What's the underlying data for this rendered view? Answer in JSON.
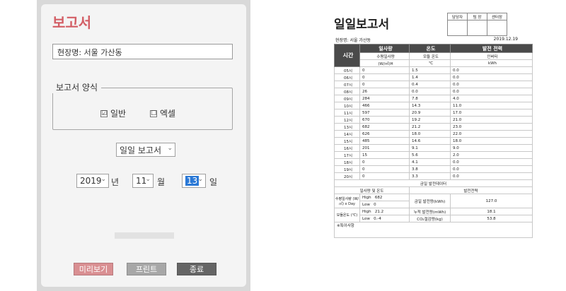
{
  "dialog": {
    "title": "보고서",
    "site_value": "현장명: 서울 가산동",
    "format_legend": "보고서 양식",
    "options": [
      {
        "label": "일반",
        "checked": true,
        "mark": "☑"
      },
      {
        "label": "엑셀",
        "checked": false,
        "mark": "☐"
      }
    ],
    "report_type": "일일 보고서",
    "year": "2019",
    "year_unit": "년",
    "month": "11",
    "month_unit": "월",
    "day": "13",
    "day_unit": "일",
    "progress": 0,
    "buttons": {
      "preview": "미리보기",
      "print": "프린트",
      "close": "종료"
    },
    "colors": {
      "title": "#d35f66",
      "preview": "#d98f92",
      "print": "#a7a7a7",
      "close": "#656565"
    }
  },
  "report": {
    "title": "일일보고서",
    "approval": [
      "담당자",
      "팀 장",
      "센터장"
    ],
    "site": "현장명: 서울 가산동",
    "date": "2019.12.19",
    "time_header": "시간",
    "group_headers": [
      "일사량",
      "온도",
      "발전 전력"
    ],
    "sub_headers": [
      "수평일사량",
      "모듈 온도",
      "인버터"
    ],
    "unit_headers": [
      "(W/㎡)H",
      "℃",
      "kWh"
    ],
    "rows": [
      {
        "t": "05시",
        "a": "0",
        "b": "1.5",
        "c": "0.0"
      },
      {
        "t": "06시",
        "a": "0",
        "b": "1.4",
        "c": "0.0"
      },
      {
        "t": "07시",
        "a": "0",
        "b": "0.4",
        "c": "0.0"
      },
      {
        "t": "08시",
        "a": "26",
        "b": "0.0",
        "c": "0.0"
      },
      {
        "t": "09시",
        "a": "284",
        "b": "7.8",
        "c": "4.0"
      },
      {
        "t": "10시",
        "a": "466",
        "b": "14.3",
        "c": "11.0"
      },
      {
        "t": "11시",
        "a": "597",
        "b": "20.9",
        "c": "17.0"
      },
      {
        "t": "12시",
        "a": "670",
        "b": "19.2",
        "c": "21.0"
      },
      {
        "t": "13시",
        "a": "682",
        "b": "21.2",
        "c": "23.0"
      },
      {
        "t": "14시",
        "a": "626",
        "b": "18.0",
        "c": "22.0"
      },
      {
        "t": "15시",
        "a": "485",
        "b": "14.6",
        "c": "18.0"
      },
      {
        "t": "16시",
        "a": "201",
        "b": "9.1",
        "c": "9.0"
      },
      {
        "t": "17시",
        "a": "15",
        "b": "5.6",
        "c": "2.0"
      },
      {
        "t": "18시",
        "a": "0",
        "b": "4.1",
        "c": "0.0"
      },
      {
        "t": "19시",
        "a": "0",
        "b": "3.8",
        "c": "0.0"
      },
      {
        "t": "20시",
        "a": "0",
        "b": "3.3",
        "c": "0.0"
      }
    ],
    "summary_title": "금일 발전데이터",
    "summary_left": "일사량 및 온도",
    "summary_right": "발전전력",
    "irr_label": "수평일사량 (W/㎡) x Day",
    "irr_high_label": "High",
    "irr_high": "682",
    "irr_low_label": "Low",
    "irr_low": "0",
    "temp_label": "모듈온도 (℃)",
    "temp_high_label": "High",
    "temp_high": "21.2",
    "temp_low_label": "Low",
    "temp_low": "0.-4",
    "today_label": "금일 발전량(kWh)",
    "today_value": "127.0",
    "cum_label": "누적 발전량(mWh)",
    "cum_value": "18.1",
    "co2_label": "CO₂절감량(kg)",
    "co2_value": "53.8",
    "remarks": "※특이사항"
  }
}
